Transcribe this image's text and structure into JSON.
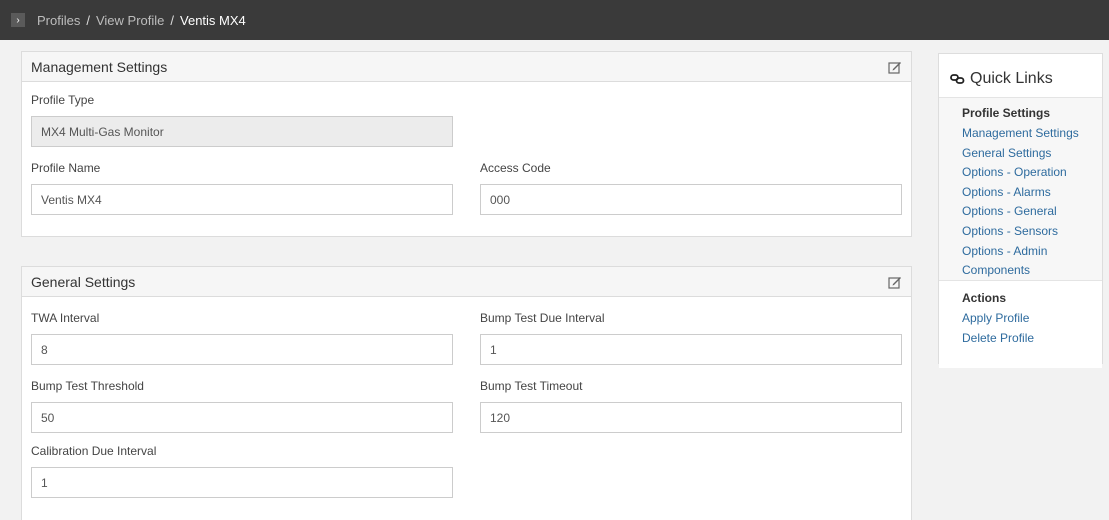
{
  "breadcrumb": {
    "items": [
      "Profiles",
      "View Profile"
    ],
    "current": "Ventis MX4",
    "separator": "/"
  },
  "management": {
    "title": "Management Settings",
    "profile_type": {
      "label": "Profile Type",
      "value": "MX4 Multi-Gas Monitor"
    },
    "profile_name": {
      "label": "Profile Name",
      "value": "Ventis MX4"
    },
    "access_code": {
      "label": "Access Code",
      "value": "000"
    }
  },
  "general": {
    "title": "General Settings",
    "twa_interval": {
      "label": "TWA Interval",
      "value": "8"
    },
    "bump_due_interval": {
      "label": "Bump Test Due Interval",
      "value": "1"
    },
    "bump_threshold": {
      "label": "Bump Test Threshold",
      "value": "50"
    },
    "bump_timeout": {
      "label": "Bump Test Timeout",
      "value": "120"
    },
    "calibration_due": {
      "label": "Calibration Due Interval",
      "value": "1"
    }
  },
  "quick_links": {
    "title": "Quick Links",
    "settings_heading": "Profile Settings",
    "settings_links": [
      "Management Settings",
      "General Settings",
      "Options - Operation",
      "Options - Alarms",
      "Options - General",
      "Options - Sensors",
      "Options - Admin",
      "Components"
    ],
    "actions_heading": "Actions",
    "action_links": [
      "Apply Profile",
      "Delete Profile"
    ]
  },
  "colors": {
    "topbar": "#3a3a3a",
    "link": "#2e6b9e",
    "background": "#f2f2f2"
  },
  "icons": {
    "breadcrumb_toggle": "chevron-right-icon",
    "edit": "edit-icon",
    "quick_links": "link-icon"
  }
}
